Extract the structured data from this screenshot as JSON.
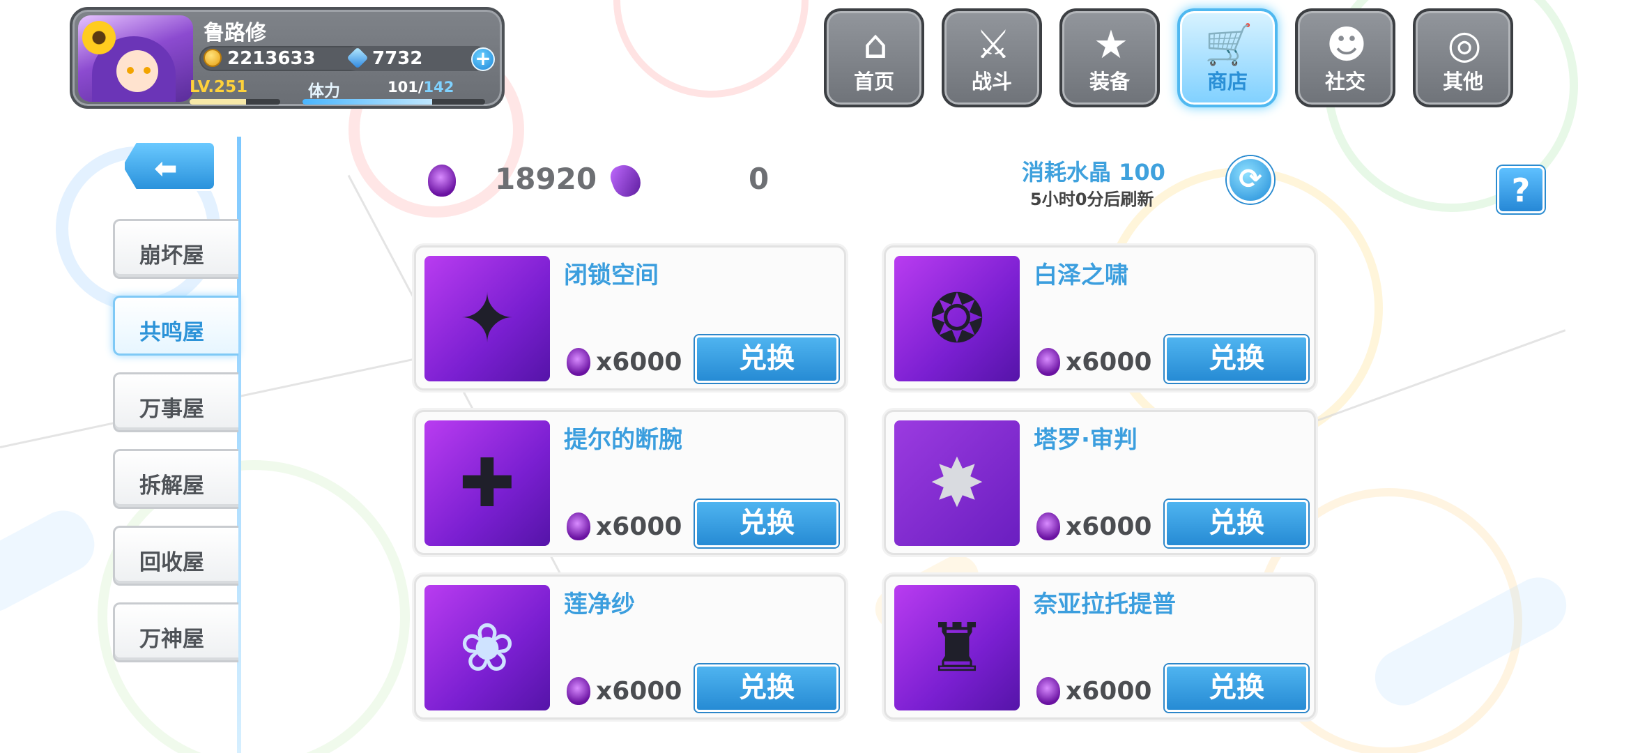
{
  "profile": {
    "username": "鲁路修",
    "gold": "2213633",
    "gems": "7732",
    "level": "LV.251",
    "level_progress": 0.62,
    "stamina_label": "体力",
    "stamina_current": "101",
    "stamina_max": "142",
    "plus_label": "+"
  },
  "nav": [
    {
      "label": "首页",
      "icon": "house-icon",
      "glyph": "⌂"
    },
    {
      "label": "战斗",
      "icon": "crossed-guns-icon",
      "glyph": "⚔"
    },
    {
      "label": "装备",
      "icon": "star-gun-icon",
      "glyph": "★"
    },
    {
      "label": "商店",
      "icon": "cart-icon",
      "glyph": "🛒",
      "active": true
    },
    {
      "label": "社交",
      "icon": "ghost-icon",
      "glyph": "☻"
    },
    {
      "label": "其他",
      "icon": "gear-icon",
      "glyph": "◎"
    }
  ],
  "sidebar": {
    "back_glyph": "⬅",
    "items": [
      {
        "label": "崩坏屋"
      },
      {
        "label": "共鸣屋",
        "active": true
      },
      {
        "label": "万事屋"
      },
      {
        "label": "拆解屋"
      },
      {
        "label": "回收屋"
      },
      {
        "label": "万神屋"
      }
    ]
  },
  "resources": {
    "crystal_amount": "18920",
    "secondary_amount": "0",
    "cost_text": "消耗水晶 100",
    "refresh_text": "5小时0分后刷新",
    "refresh_glyph": "⟳",
    "help_glyph": "?"
  },
  "items": [
    {
      "name": "闭锁空间",
      "price": "x6000",
      "button": "兑换",
      "glyph": "✦"
    },
    {
      "name": "白泽之啸",
      "price": "x6000",
      "button": "兑换",
      "glyph": "❂"
    },
    {
      "name": "提尔的断腕",
      "price": "x6000",
      "button": "兑换",
      "glyph": "✚"
    },
    {
      "name": "塔罗·审判",
      "price": "x6000",
      "button": "兑换",
      "glyph": "✸"
    },
    {
      "name": "莲净纱",
      "price": "x6000",
      "button": "兑换",
      "glyph": "❀"
    },
    {
      "name": "奈亚拉托提普",
      "price": "x6000",
      "button": "兑换",
      "glyph": "♜"
    }
  ],
  "colors": {
    "accent_blue": "#3b9ede",
    "crystal_purple": "#8c2cd0",
    "nav_gray": "#7f8389"
  }
}
